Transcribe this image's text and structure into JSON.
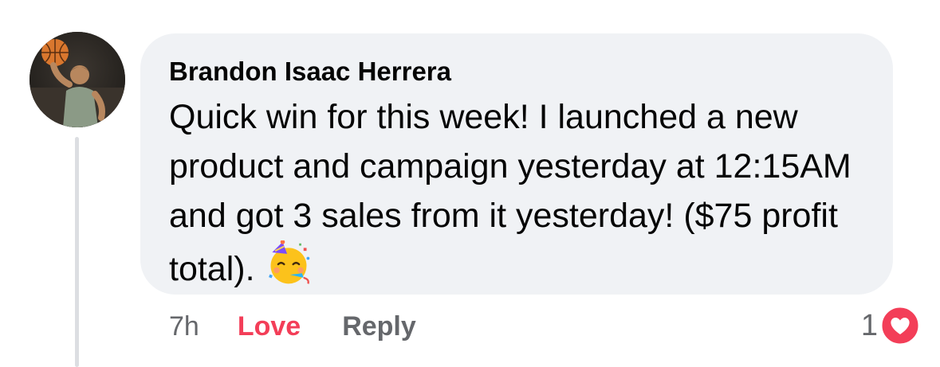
{
  "comment": {
    "author": "Brandon Isaac Herrera",
    "text": "Quick win for this week! I launched a new product and campaign yesterday at 12:15AM and got 3 sales from it yesterday! ($75 profit total).",
    "emoji_icon": "partying-face-icon",
    "timestamp": "7h",
    "actions": {
      "love_label": "Love",
      "reply_label": "Reply"
    },
    "reactions": {
      "count": "1",
      "icon": "love-heart-icon",
      "color": "#f33e58"
    }
  },
  "colors": {
    "bubble": "#f0f2f5",
    "secondary_text": "#65676b",
    "love": "#f33e58",
    "thread_line": "#dcdee2"
  }
}
